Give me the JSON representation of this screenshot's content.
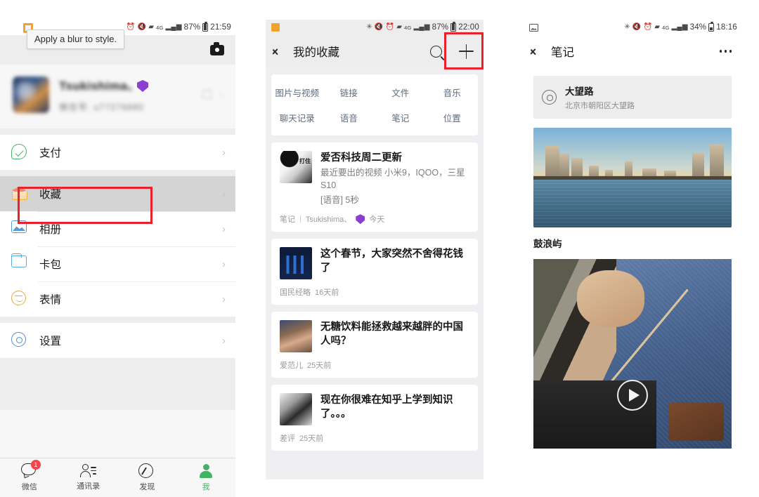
{
  "annotation": {
    "tooltip_text": "Apply a blur to style.",
    "highlight_color": "#e8212b"
  },
  "panel1": {
    "status": {
      "time": "21:59",
      "battery": "87%",
      "network": "4G",
      "icons": [
        "alarm-icon",
        "mute-icon",
        "wifi-icon",
        "signal-icon",
        "battery-icon"
      ]
    },
    "nav": {
      "camera_label": "camera-icon"
    },
    "profile": {
      "name": "Tsukishima、",
      "subtitle": "微信号: u77276880",
      "badge": "purple-shield-badge"
    },
    "menu": [
      {
        "label": "支付",
        "icon": "pay-icon",
        "chevron": "›",
        "selected": false
      },
      {
        "label": "收藏",
        "icon": "favorites-icon",
        "chevron": "›",
        "selected": true
      },
      {
        "label": "相册",
        "icon": "album-icon",
        "chevron": "›",
        "selected": false
      },
      {
        "label": "卡包",
        "icon": "card-wallet-icon",
        "chevron": "›",
        "selected": false
      },
      {
        "label": "表情",
        "icon": "emoji-icon",
        "chevron": "›",
        "selected": false
      },
      {
        "label": "设置",
        "icon": "settings-gear-icon",
        "chevron": "›",
        "selected": false
      }
    ],
    "tabs": [
      {
        "label": "微信",
        "icon": "chat-icon",
        "badge": "1",
        "active": false
      },
      {
        "label": "通讯录",
        "icon": "contacts-icon",
        "badge": "",
        "active": false
      },
      {
        "label": "发现",
        "icon": "discover-compass-icon",
        "badge": "",
        "active": false
      },
      {
        "label": "我",
        "icon": "me-person-icon",
        "badge": "",
        "active": true
      }
    ]
  },
  "panel2": {
    "status": {
      "time": "22:00",
      "battery": "87%",
      "network": "4G",
      "icons": [
        "app-icon",
        "bluetooth-icon",
        "mute-icon",
        "alarm-icon",
        "wifi-icon",
        "signal-icon",
        "battery-icon"
      ]
    },
    "nav": {
      "back": "back-chevron-icon",
      "title": "我的收藏",
      "search": "search-icon",
      "add": "plus-icon"
    },
    "filters": [
      [
        "图片与视频",
        "链接",
        "文件",
        "音乐"
      ],
      [
        "聊天记录",
        "语音",
        "笔记",
        "位置"
      ]
    ],
    "items": [
      {
        "title": "爱否科技周二更新",
        "subtitle_lines": [
          "最近要出的视频  小米9，IQOO，三星S10",
          "[语音] 5秒"
        ],
        "meta_type": "笔记",
        "meta_sep": "|",
        "meta_author": "Tsukishima、",
        "meta_badge": "purple-shield-badge",
        "meta_time": "今天",
        "thumb": "thumb-hand-photo"
      },
      {
        "title": "这个春节，大家突然不舍得花钱了",
        "subtitle_lines": [],
        "meta_type": "",
        "meta_sep": "",
        "meta_author": "国民经略",
        "meta_badge": "",
        "meta_time": "16天前",
        "thumb": "thumb-bar-chart"
      },
      {
        "title": "无糖饮料能拯救越来越胖的中国人吗？",
        "subtitle_lines": [],
        "meta_type": "",
        "meta_sep": "",
        "meta_author": "爱范儿",
        "meta_badge": "",
        "meta_time": "25天前",
        "thumb": "thumb-child-drinking"
      },
      {
        "title": "现在你很难在知乎上学到知识了。。。",
        "subtitle_lines": [],
        "meta_type": "",
        "meta_sep": "",
        "meta_author": "差评",
        "meta_badge": "",
        "meta_time": "25天前",
        "thumb": "thumb-grey-photo"
      }
    ]
  },
  "panel3": {
    "status": {
      "time": "18:16",
      "battery": "34%",
      "network": "4G",
      "icons": [
        "photo-icon",
        "bluetooth-icon",
        "mute-icon",
        "alarm-icon",
        "wifi-icon",
        "signal-icon",
        "battery-icon"
      ]
    },
    "nav": {
      "back": "back-chevron-icon",
      "title": "笔记",
      "more": "more-dots-icon"
    },
    "location": {
      "icon": "location-pin-icon",
      "name": "大望路",
      "address": "北京市朝阳区大望路"
    },
    "photo_alt": "city-skyline-photo",
    "caption": "鼓浪屿",
    "video": {
      "alt": "violin-bow-video",
      "play_icon": "play-button-icon"
    }
  }
}
